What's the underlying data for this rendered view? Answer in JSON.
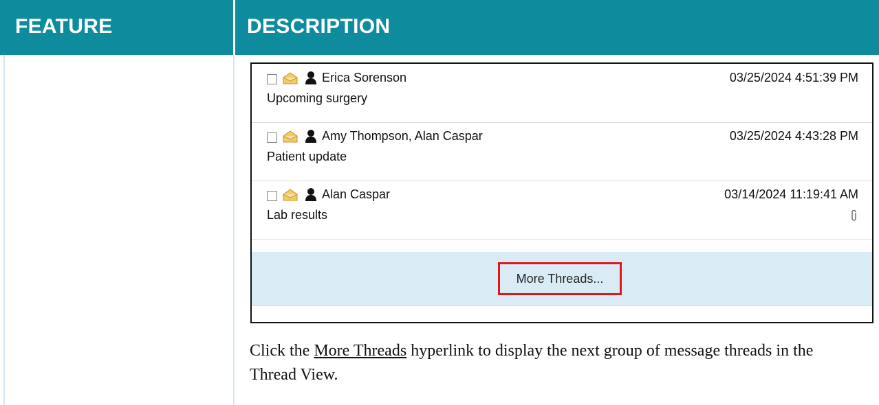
{
  "header": {
    "col_feature": "FEATURE",
    "col_description": "DESCRIPTION",
    "bg_color": "#0e8c9e"
  },
  "threads": [
    {
      "sender": "Erica Sorenson",
      "subject": "Upcoming surgery",
      "date": "03/25/2024 4:51:39 PM",
      "attachment": false
    },
    {
      "sender": "Amy Thompson, Alan Caspar",
      "subject": "Patient update",
      "date": "03/25/2024 4:43:28 PM",
      "attachment": false
    },
    {
      "sender": "Alan Caspar",
      "subject": "Lab results",
      "date": "03/14/2024 11:19:41 AM",
      "attachment": true
    }
  ],
  "more_threads": {
    "label": "More Threads...",
    "highlight_color": "#e3151b",
    "bar_color": "#d9ecf6"
  },
  "description": {
    "prefix": "Click the ",
    "link_text": "More Threads",
    "suffix": " hyperlink to display the next group of message threads in the Thread View."
  },
  "icons": {
    "checkbox": "checkbox-icon",
    "envelope": "open-envelope-icon",
    "person": "person-icon",
    "attachment": "paperclip-icon"
  }
}
